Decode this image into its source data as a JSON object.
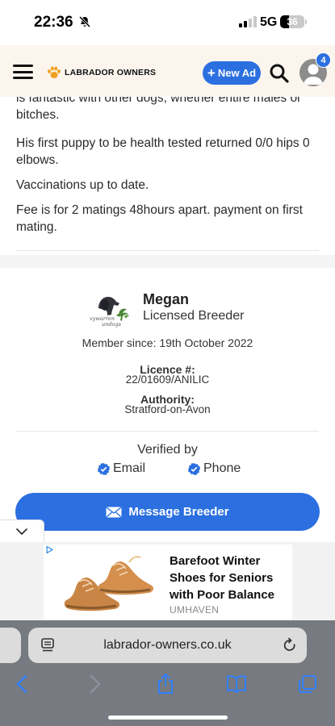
{
  "status_bar": {
    "time": "22:36",
    "network": "5G",
    "battery": "36"
  },
  "header": {
    "site_name": "LABRADOR OWNERS",
    "new_ad_label": "New Ad",
    "new_ad_plus": "+",
    "notification_count": "4"
  },
  "description": {
    "cut_line": "is fantastic with other dogs, whether entire males or bitches.",
    "paragraphs": [
      "His first puppy to be health tested returned 0/0 hips 0 elbows.",
      "Vaccinations up to date.",
      "Fee is for 2 matings 48hours apart. payment on first mating."
    ]
  },
  "breeder": {
    "logo_text_line1": "vywarren",
    "logo_text_line2": "undogs",
    "name": "Megan",
    "role": "Licensed Breeder",
    "member_since": "Member since: 19th October 2022",
    "licence_label": "Licence #:",
    "licence_value": "22/01609/ANILIC",
    "authority_label": "Authority:",
    "authority_value": "Stratford-on-Avon",
    "verified_by": "Verified by",
    "verified_items": [
      "Email",
      "Phone"
    ],
    "message_button": "Message Breeder"
  },
  "ad": {
    "title": "Barefoot Winter Shoes for Seniors with Poor Balance",
    "brand": "UMHAVEN"
  },
  "browser": {
    "url": "labrador-owners.co.uk"
  },
  "colors": {
    "accent": "#2b6fe0",
    "header_bg": "#fbf5ee",
    "paw": "#f0a020"
  }
}
